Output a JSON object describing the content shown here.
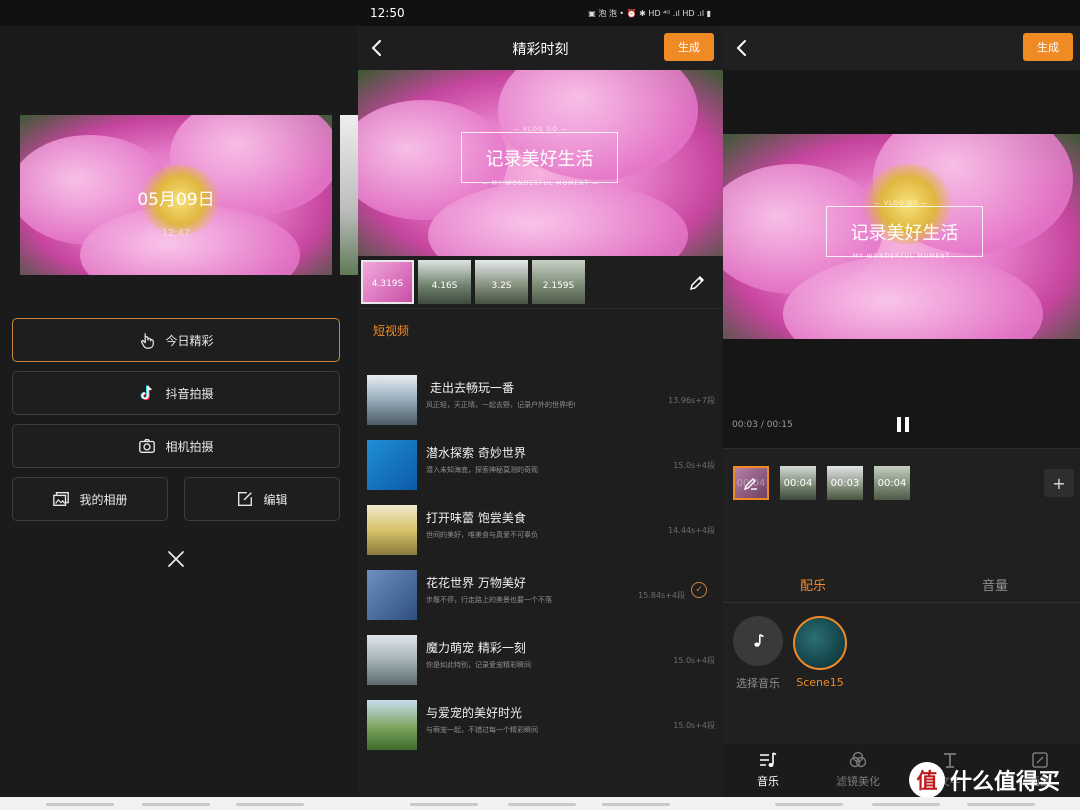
{
  "colors": {
    "accent": "#f08a24",
    "background": "#1e1e1e",
    "card_border": "#3c3c3c"
  },
  "panel1": {
    "card_date": "05月09日",
    "card_time": "12:47",
    "menu": [
      {
        "label": "今日精彩",
        "icon": "hand-pointer-icon",
        "active": true
      },
      {
        "label": "抖音拍摄",
        "icon": "tiktok-icon",
        "active": false
      },
      {
        "label": "相机拍摄",
        "icon": "camera-icon",
        "active": false
      },
      {
        "label": "我的相册",
        "icon": "album-icon",
        "active": false
      },
      {
        "label": "编辑",
        "icon": "edit-icon",
        "active": false
      }
    ]
  },
  "panel2": {
    "status_time": "12:50",
    "status_icons": "▣ 泡 泡 • ⏰ ✱ HD ⁴ᴳ .ıl HD .ıl ▮",
    "title": "精彩时刻",
    "generate": "生成",
    "overlay_top": "— VLOG GO —",
    "overlay_title": "记录美好生活",
    "overlay_bottom": "— MY WONDERFUL MOMENT —",
    "thumbs": [
      "4.319S",
      "4.16S",
      "3.2S",
      "2.159S"
    ],
    "section_title": "短视频",
    "list": [
      {
        "title": "走出去畅玩一番",
        "subtitle": "风正轻，天正晴，一起去野，记录户外的世界吧!",
        "meta": "13.96s+7段"
      },
      {
        "title": "潜水探索 奇妙世界",
        "subtitle": "潜入未知海底，探索神秘莫测的奇观",
        "meta": "15.0s+4段"
      },
      {
        "title": "打开味蕾 饱尝美食",
        "subtitle": "世间的美好，唯美食与真爱不可辜负",
        "meta": "14.44s+4段"
      },
      {
        "title": "花花世界 万物美好",
        "subtitle": "步履不停，行走路上的美景也要一个不落",
        "meta": "15.84s+4段",
        "checked": true
      },
      {
        "title": "魔力萌宠 精彩一刻",
        "subtitle": "你是如此特别，记录爱宠精彩瞬间",
        "meta": "15.0s+4段"
      },
      {
        "title": "与爱宠的美好时光",
        "subtitle": "与萌宠一起，不错过每一个精彩瞬间",
        "meta": "15.0s+4段"
      }
    ]
  },
  "panel3": {
    "generate": "生成",
    "overlay_top": "— VLOG GO —",
    "overlay_title": "记录美好生活",
    "overlay_bottom": "— MY WONDERFUL MOMENT —",
    "time_current": "00:03",
    "time_sep": "/",
    "time_total": "00:15",
    "clips": [
      "00:04",
      "00:04",
      "00:03",
      "00:04"
    ],
    "tab_music": "配乐",
    "tab_volume": "音量",
    "music_items": [
      {
        "label": "选择音乐",
        "icon": "music-note-icon"
      },
      {
        "label": "Scene15",
        "selected": true
      }
    ],
    "bottom_nav": [
      {
        "label": "音乐",
        "icon": "music-icon",
        "active": true
      },
      {
        "label": "滤镜美化",
        "icon": "filter-icon",
        "active": false
      },
      {
        "label": "文字",
        "icon": "text-icon",
        "active": false
      },
      {
        "label": "画面",
        "icon": "frame-icon",
        "active": false
      }
    ],
    "watermark_badge": "值",
    "watermark_text": "什么值得买"
  }
}
